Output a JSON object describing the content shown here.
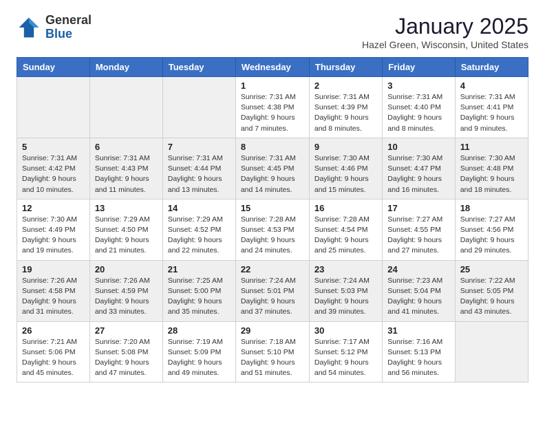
{
  "header": {
    "logo_general": "General",
    "logo_blue": "Blue",
    "month": "January 2025",
    "location": "Hazel Green, Wisconsin, United States"
  },
  "days_of_week": [
    "Sunday",
    "Monday",
    "Tuesday",
    "Wednesday",
    "Thursday",
    "Friday",
    "Saturday"
  ],
  "weeks": [
    {
      "days": [
        {
          "num": "",
          "info": ""
        },
        {
          "num": "",
          "info": ""
        },
        {
          "num": "",
          "info": ""
        },
        {
          "num": "1",
          "info": "Sunrise: 7:31 AM\nSunset: 4:38 PM\nDaylight: 9 hours and 7 minutes."
        },
        {
          "num": "2",
          "info": "Sunrise: 7:31 AM\nSunset: 4:39 PM\nDaylight: 9 hours and 8 minutes."
        },
        {
          "num": "3",
          "info": "Sunrise: 7:31 AM\nSunset: 4:40 PM\nDaylight: 9 hours and 8 minutes."
        },
        {
          "num": "4",
          "info": "Sunrise: 7:31 AM\nSunset: 4:41 PM\nDaylight: 9 hours and 9 minutes."
        }
      ]
    },
    {
      "days": [
        {
          "num": "5",
          "info": "Sunrise: 7:31 AM\nSunset: 4:42 PM\nDaylight: 9 hours and 10 minutes."
        },
        {
          "num": "6",
          "info": "Sunrise: 7:31 AM\nSunset: 4:43 PM\nDaylight: 9 hours and 11 minutes."
        },
        {
          "num": "7",
          "info": "Sunrise: 7:31 AM\nSunset: 4:44 PM\nDaylight: 9 hours and 13 minutes."
        },
        {
          "num": "8",
          "info": "Sunrise: 7:31 AM\nSunset: 4:45 PM\nDaylight: 9 hours and 14 minutes."
        },
        {
          "num": "9",
          "info": "Sunrise: 7:30 AM\nSunset: 4:46 PM\nDaylight: 9 hours and 15 minutes."
        },
        {
          "num": "10",
          "info": "Sunrise: 7:30 AM\nSunset: 4:47 PM\nDaylight: 9 hours and 16 minutes."
        },
        {
          "num": "11",
          "info": "Sunrise: 7:30 AM\nSunset: 4:48 PM\nDaylight: 9 hours and 18 minutes."
        }
      ]
    },
    {
      "days": [
        {
          "num": "12",
          "info": "Sunrise: 7:30 AM\nSunset: 4:49 PM\nDaylight: 9 hours and 19 minutes."
        },
        {
          "num": "13",
          "info": "Sunrise: 7:29 AM\nSunset: 4:50 PM\nDaylight: 9 hours and 21 minutes."
        },
        {
          "num": "14",
          "info": "Sunrise: 7:29 AM\nSunset: 4:52 PM\nDaylight: 9 hours and 22 minutes."
        },
        {
          "num": "15",
          "info": "Sunrise: 7:28 AM\nSunset: 4:53 PM\nDaylight: 9 hours and 24 minutes."
        },
        {
          "num": "16",
          "info": "Sunrise: 7:28 AM\nSunset: 4:54 PM\nDaylight: 9 hours and 25 minutes."
        },
        {
          "num": "17",
          "info": "Sunrise: 7:27 AM\nSunset: 4:55 PM\nDaylight: 9 hours and 27 minutes."
        },
        {
          "num": "18",
          "info": "Sunrise: 7:27 AM\nSunset: 4:56 PM\nDaylight: 9 hours and 29 minutes."
        }
      ]
    },
    {
      "days": [
        {
          "num": "19",
          "info": "Sunrise: 7:26 AM\nSunset: 4:58 PM\nDaylight: 9 hours and 31 minutes."
        },
        {
          "num": "20",
          "info": "Sunrise: 7:26 AM\nSunset: 4:59 PM\nDaylight: 9 hours and 33 minutes."
        },
        {
          "num": "21",
          "info": "Sunrise: 7:25 AM\nSunset: 5:00 PM\nDaylight: 9 hours and 35 minutes."
        },
        {
          "num": "22",
          "info": "Sunrise: 7:24 AM\nSunset: 5:01 PM\nDaylight: 9 hours and 37 minutes."
        },
        {
          "num": "23",
          "info": "Sunrise: 7:24 AM\nSunset: 5:03 PM\nDaylight: 9 hours and 39 minutes."
        },
        {
          "num": "24",
          "info": "Sunrise: 7:23 AM\nSunset: 5:04 PM\nDaylight: 9 hours and 41 minutes."
        },
        {
          "num": "25",
          "info": "Sunrise: 7:22 AM\nSunset: 5:05 PM\nDaylight: 9 hours and 43 minutes."
        }
      ]
    },
    {
      "days": [
        {
          "num": "26",
          "info": "Sunrise: 7:21 AM\nSunset: 5:06 PM\nDaylight: 9 hours and 45 minutes."
        },
        {
          "num": "27",
          "info": "Sunrise: 7:20 AM\nSunset: 5:08 PM\nDaylight: 9 hours and 47 minutes."
        },
        {
          "num": "28",
          "info": "Sunrise: 7:19 AM\nSunset: 5:09 PM\nDaylight: 9 hours and 49 minutes."
        },
        {
          "num": "29",
          "info": "Sunrise: 7:18 AM\nSunset: 5:10 PM\nDaylight: 9 hours and 51 minutes."
        },
        {
          "num": "30",
          "info": "Sunrise: 7:17 AM\nSunset: 5:12 PM\nDaylight: 9 hours and 54 minutes."
        },
        {
          "num": "31",
          "info": "Sunrise: 7:16 AM\nSunset: 5:13 PM\nDaylight: 9 hours and 56 minutes."
        },
        {
          "num": "",
          "info": ""
        }
      ]
    }
  ]
}
